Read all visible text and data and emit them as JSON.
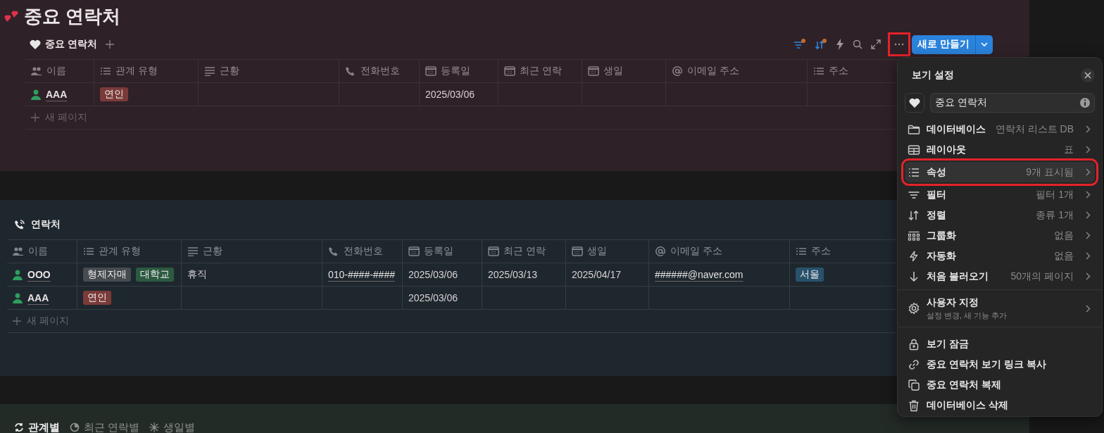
{
  "page": {
    "title": "중요 연락처"
  },
  "view_tabs": [
    {
      "label": "중요 연락처",
      "selected": true
    }
  ],
  "toolbar": {
    "filter_active": true,
    "sort_active": true,
    "more_highlighted": true,
    "new_button": "새로 만들기"
  },
  "table_1": {
    "columns": [
      "이름",
      "관계 유형",
      "근황",
      "전화번호",
      "등록일",
      "최근 연락",
      "생일",
      "이메일 주소",
      "주소"
    ],
    "rows": [
      {
        "cells": [
          {
            "kind": "title",
            "text": "AAA"
          },
          {
            "kind": "tags",
            "tags": [
              {
                "label": "연인",
                "color": "#7a3b38"
              }
            ]
          },
          {
            "kind": "empty"
          },
          {
            "kind": "empty"
          },
          {
            "kind": "text",
            "text": "2025/03/06"
          },
          {
            "kind": "empty"
          },
          {
            "kind": "empty"
          },
          {
            "kind": "empty"
          },
          {
            "kind": "empty"
          }
        ]
      }
    ],
    "new_row": "새 페이지"
  },
  "section_2": {
    "title": "연락처"
  },
  "table_2": {
    "columns": [
      "이름",
      "관계 유형",
      "근황",
      "전화번호",
      "등록일",
      "최근 연락",
      "생일",
      "이메일 주소",
      "주소"
    ],
    "rows": [
      {
        "cells": [
          {
            "kind": "title",
            "text": "OOO"
          },
          {
            "kind": "tags",
            "tags": [
              {
                "label": "형제자매",
                "color": "#454b4f"
              },
              {
                "label": "대학교",
                "color": "#2b5a40"
              }
            ]
          },
          {
            "kind": "text",
            "text": "휴직"
          },
          {
            "kind": "link",
            "text": "010-####-####"
          },
          {
            "kind": "text",
            "text": "2025/03/06"
          },
          {
            "kind": "text",
            "text": "2025/03/13"
          },
          {
            "kind": "text",
            "text": "2025/04/17"
          },
          {
            "kind": "link",
            "text": "######@naver.com"
          },
          {
            "kind": "tags",
            "tags": [
              {
                "label": "서울",
                "color": "#28526c"
              }
            ]
          }
        ]
      },
      {
        "cells": [
          {
            "kind": "title",
            "text": "AAA"
          },
          {
            "kind": "tags",
            "tags": [
              {
                "label": "연인",
                "color": "#7a3b38"
              }
            ]
          },
          {
            "kind": "empty"
          },
          {
            "kind": "empty"
          },
          {
            "kind": "text",
            "text": "2025/03/06"
          },
          {
            "kind": "empty"
          },
          {
            "kind": "empty"
          },
          {
            "kind": "empty"
          },
          {
            "kind": "empty"
          }
        ]
      }
    ],
    "new_row": "새 페이지"
  },
  "section_3": {
    "tabs": [
      {
        "label": "관계별",
        "selected": true
      },
      {
        "label": "최근 연락별",
        "selected": false
      },
      {
        "label": "생일별",
        "selected": false
      }
    ]
  },
  "view_settings": {
    "title": "보기 설정",
    "name_value": "중요 연락처",
    "settings": [
      {
        "label": "데이터베이스",
        "value": "연락처 리스트 DB",
        "highlighted": false
      },
      {
        "label": "레이아웃",
        "value": "표",
        "highlighted": false
      },
      {
        "label": "속성",
        "value": "9개 표시됨",
        "highlighted": true
      },
      {
        "label": "필터",
        "value": "필터 1개",
        "highlighted": false
      },
      {
        "label": "정렬",
        "value": "종류 1개",
        "highlighted": false
      },
      {
        "label": "그룹화",
        "value": "없음",
        "highlighted": false
      },
      {
        "label": "자동화",
        "value": "없음",
        "highlighted": false
      },
      {
        "label": "처음 불러오기",
        "value": "50개의 페이지",
        "highlighted": false
      }
    ],
    "customize": {
      "label": "사용자 지정",
      "subtitle": "설정 변경, 새 기능 추가"
    },
    "actions": [
      "보기 잠금",
      "중요 연락처 보기 링크 복사",
      "중요 연락처 복제",
      "데이터베이스 삭제"
    ]
  }
}
